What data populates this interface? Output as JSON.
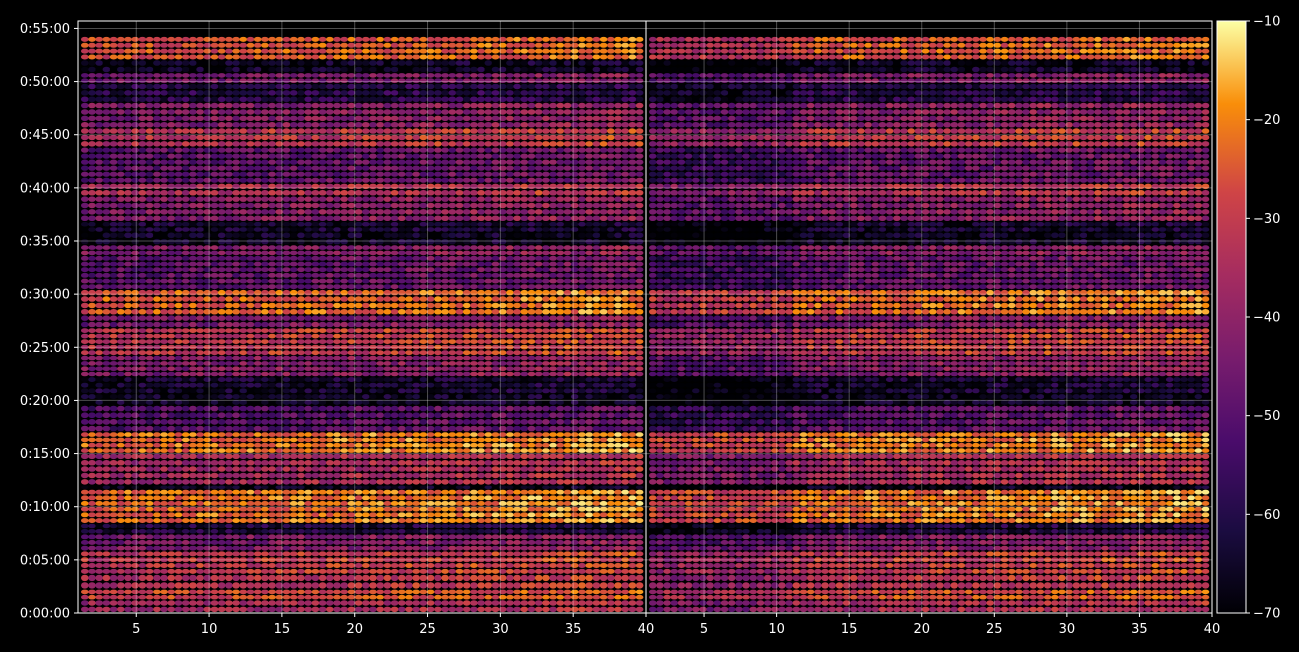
{
  "chart_data": {
    "type": "heatmap",
    "background_color": "#000000",
    "colormap": "inferno",
    "grid": true,
    "panels": [
      {
        "name": "",
        "x_range": [
          1,
          40
        ]
      },
      {
        "name": "",
        "x_range": [
          1,
          40
        ]
      }
    ],
    "x_ticks": [
      "5",
      "10",
      "15",
      "20",
      "25",
      "30",
      "35",
      "40"
    ],
    "x_tick_values": [
      5,
      10,
      15,
      20,
      25,
      30,
      35,
      40
    ],
    "y_ticks": [
      "0:00:00",
      "0:05:00",
      "0:10:00",
      "0:15:00",
      "0:20:00",
      "0:25:00",
      "0:30:00",
      "0:35:00",
      "0:40:00",
      "0:45:00",
      "0:50:00",
      "0:55:00"
    ],
    "y_range_minutes": [
      0,
      55.7
    ],
    "colorbar": {
      "range": [
        -70,
        -10
      ],
      "ticks": [
        "−10",
        "−20",
        "−30",
        "−40",
        "−50",
        "−60",
        "−70"
      ],
      "tick_values": [
        -10,
        -20,
        -30,
        -40,
        -50,
        -60,
        -70
      ]
    },
    "bands": [
      {
        "y": [
          0.0,
          1.2
        ],
        "value": -38
      },
      {
        "y": [
          1.2,
          2.2
        ],
        "value": -30
      },
      {
        "y": [
          2.2,
          3.6
        ],
        "value": -35
      },
      {
        "y": [
          3.6,
          5.8
        ],
        "value": -33
      },
      {
        "y": [
          5.8,
          7.4
        ],
        "value": -45
      },
      {
        "y": [
          7.4,
          8.4
        ],
        "value": -62
      },
      {
        "y": [
          8.4,
          11.6
        ],
        "value": -24
      },
      {
        "y": [
          11.6,
          12.0
        ],
        "value": -68
      },
      {
        "y": [
          12.0,
          15.0
        ],
        "value": -38
      },
      {
        "y": [
          15.0,
          17.0
        ],
        "value": -24
      },
      {
        "y": [
          17.0,
          19.5
        ],
        "value": -52
      },
      {
        "y": [
          19.5,
          20.6
        ],
        "value": -66
      },
      {
        "y": [
          20.6,
          22.2
        ],
        "value": -64
      },
      {
        "y": [
          22.2,
          24.2
        ],
        "value": -44
      },
      {
        "y": [
          24.2,
          26.8
        ],
        "value": -33
      },
      {
        "y": [
          26.8,
          28.0
        ],
        "value": -46
      },
      {
        "y": [
          28.0,
          30.4
        ],
        "value": -26
      },
      {
        "y": [
          30.4,
          33.6
        ],
        "value": -50
      },
      {
        "y": [
          33.6,
          34.6
        ],
        "value": -44
      },
      {
        "y": [
          34.6,
          35.8
        ],
        "value": -66
      },
      {
        "y": [
          35.8,
          36.8
        ],
        "value": -64
      },
      {
        "y": [
          36.8,
          39.2
        ],
        "value": -44
      },
      {
        "y": [
          39.2,
          40.4
        ],
        "value": -36
      },
      {
        "y": [
          40.4,
          43.8
        ],
        "value": -50
      },
      {
        "y": [
          43.8,
          45.6
        ],
        "value": -34
      },
      {
        "y": [
          45.6,
          48.0
        ],
        "value": -44
      },
      {
        "y": [
          48.0,
          49.8
        ],
        "value": -60
      },
      {
        "y": [
          49.8,
          50.8
        ],
        "value": -46
      },
      {
        "y": [
          50.8,
          52.0
        ],
        "value": -66
      },
      {
        "y": [
          52.0,
          54.2
        ],
        "value": -28
      }
    ]
  }
}
